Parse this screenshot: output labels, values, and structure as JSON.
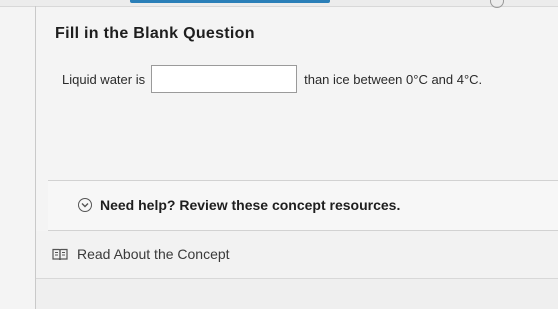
{
  "question": {
    "title": "Fill in the Blank Question",
    "text_before": "Liquid water is",
    "blank_value": "",
    "text_after": "than ice between 0°C and 4°C."
  },
  "help": {
    "label": "Need help? Review these concept resources."
  },
  "concept": {
    "label": "Read About the Concept"
  },
  "colors": {
    "accent": "#2a7fb8"
  },
  "icons": {
    "help_toggle": "chevron-down-circle-icon",
    "concept": "book-icon"
  }
}
